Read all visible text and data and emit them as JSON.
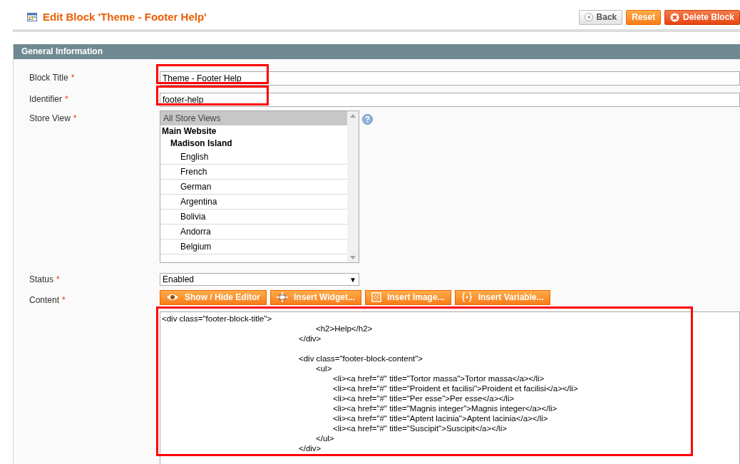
{
  "page_title": "Edit Block 'Theme - Footer Help'",
  "actions": [
    {
      "label": "Back",
      "kind": "back"
    },
    {
      "label": "Reset",
      "kind": "reset"
    },
    {
      "label": "Delete Block",
      "kind": "delete"
    }
  ],
  "section": {
    "title": "General Information"
  },
  "fields": [
    {
      "kind": "text",
      "label": "Block Title",
      "required_mark": "*",
      "value": "Theme - Footer Help",
      "highlighted": true
    },
    {
      "kind": "text",
      "label": "Identifier",
      "required_mark": "*",
      "value": "footer-help",
      "highlighted": true
    },
    {
      "kind": "multiselect",
      "label": "Store View",
      "required_mark": "*",
      "options": [
        {
          "kind": "all",
          "label": "All Store Views",
          "selected": true
        },
        {
          "kind": "website",
          "label": "Main Website",
          "selected": false
        },
        {
          "kind": "group",
          "label": "Madison Island",
          "selected": false
        },
        {
          "kind": "view",
          "label": "English",
          "selected": false
        },
        {
          "kind": "view",
          "label": "French",
          "selected": false
        },
        {
          "kind": "view",
          "label": "German",
          "selected": false
        },
        {
          "kind": "view",
          "label": "Argentina",
          "selected": false
        },
        {
          "kind": "view",
          "label": "Bolivia",
          "selected": false
        },
        {
          "kind": "view",
          "label": "Andorra",
          "selected": false
        },
        {
          "kind": "view",
          "label": "Belgium",
          "selected": false
        }
      ]
    },
    {
      "kind": "select",
      "label": "Status",
      "required_mark": "*",
      "value": "Enabled",
      "arrow": "▼"
    },
    {
      "kind": "editor",
      "label": "Content",
      "required_mark": "*",
      "highlighted": true,
      "buttons": [
        {
          "label": "Show / Hide Editor",
          "kind": "eye"
        },
        {
          "label": "Insert Widget...",
          "kind": "widget"
        },
        {
          "label": "Insert Image...",
          "kind": "image"
        },
        {
          "label": "Insert Variable...",
          "kind": "variable"
        }
      ],
      "blocks": [
        [
          "<div class=\"footer-block-title\">",
          "\t\t\t\t\t\t\t\t\t<h2>Help</h2>",
          "\t\t\t\t\t\t\t\t</div>"
        ],
        [
          "\t\t\t\t\t\t\t\t<div class=\"footer-block-content\">",
          "\t\t\t\t\t\t\t\t\t<ul>",
          "\t\t\t\t\t\t\t\t\t\t<li><a href=\"#\" title=\"Tortor massa\">Tortor massa</a></li>",
          "\t\t\t\t\t\t\t\t\t\t<li><a href=\"#\" title=\"Proident et facilisi\">Proident et facilisi</a></li>",
          "\t\t\t\t\t\t\t\t\t\t<li><a href=\"#\" title=\"Per esse\">Per esse</a></li>",
          "\t\t\t\t\t\t\t\t\t\t<li><a href=\"#\" title=\"Magnis integer\">Magnis integer</a></li>",
          "\t\t\t\t\t\t\t\t\t\t<li><a href=\"#\" title=\"Aptent lacinia\">Aptent lacinia</a></li>",
          "\t\t\t\t\t\t\t\t\t\t<li><a href=\"#\" title=\"Suscipit\">Suscipit</a></li>",
          "\t\t\t\t\t\t\t\t\t</ul>",
          "\t\t\t\t\t\t\t\t</div>"
        ]
      ]
    }
  ]
}
